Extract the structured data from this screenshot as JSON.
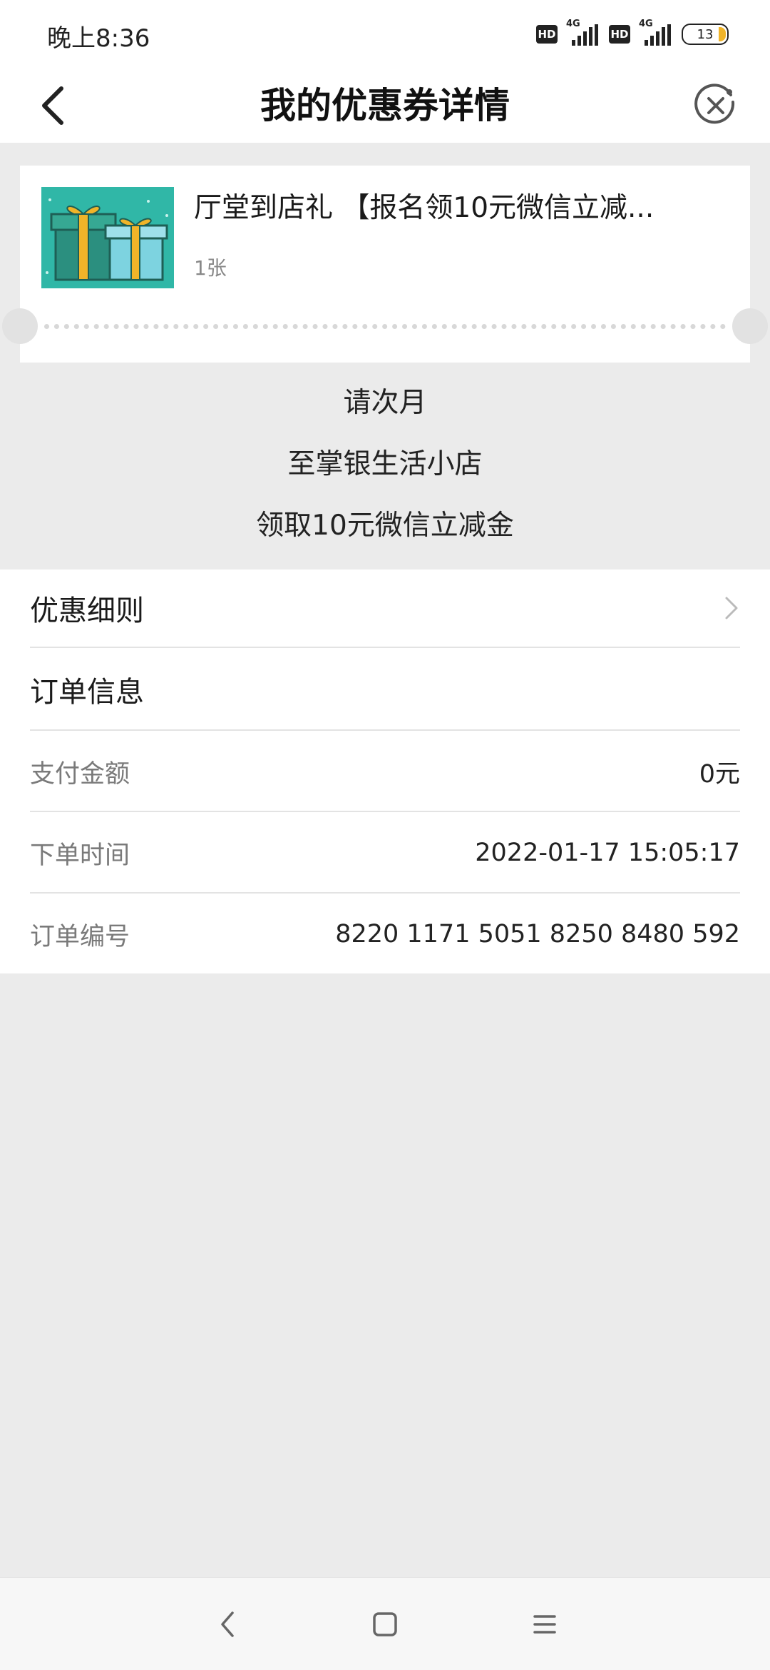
{
  "status_bar": {
    "time": "晚上8:36",
    "hd1": "HD",
    "net1": "4G",
    "hd2": "HD",
    "net2": "4G",
    "battery": "13",
    "battery_fraction": 0.13
  },
  "header": {
    "title": "我的优惠券详情",
    "back_icon": "chevron-left-icon",
    "close_icon": "close-circle-icon"
  },
  "coupon": {
    "title": "厅堂到店礼 【报名领10元微信立减...",
    "quantity": "1张",
    "image": "gift-boxes-image",
    "description_lines": [
      "请次月",
      "至掌银生活小店",
      "领取10元微信立减金"
    ]
  },
  "details": {
    "rules_label": "优惠细则",
    "order_info_label": "订单信息",
    "rows": [
      {
        "label": "支付金额",
        "value": "0元"
      },
      {
        "label": "下单时间",
        "value": "2022-01-17 15:05:17"
      },
      {
        "label": "订单编号",
        "value": "8220 1171 5051 8250 8480 592"
      }
    ]
  },
  "colors": {
    "page_background": "#ebebeb",
    "card_background": "#ffffff",
    "thumb_teal": "#30b7a7",
    "ribbon_yellow": "#f0b429"
  },
  "system_nav": {
    "back": "back-icon",
    "home": "home-icon",
    "menu": "menu-icon"
  }
}
